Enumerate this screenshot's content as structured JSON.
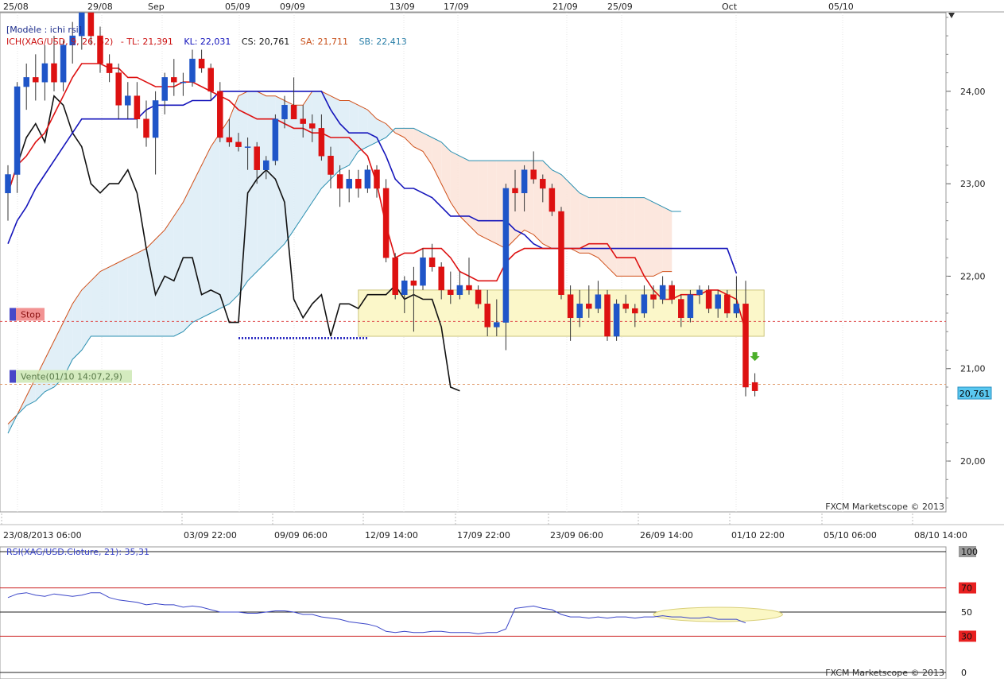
{
  "chart_data": {
    "type": "candlestick",
    "symbol": "XAG/USD",
    "header_label": "[Modèle : ichi rsi]",
    "indicator_label": {
      "ich": "ICH(XAG/USD, 9, 26, 52)",
      "tl": "- TL: 21,391",
      "kl": "KL: 22,031",
      "cs": "CS: 20,761",
      "sa": "SA: 21,711",
      "sb": "SB: 22,413"
    },
    "watermark": "FXCM Marketscope © 2013",
    "top_dates": [
      "25/08",
      "29/08",
      "Sep",
      "05/09",
      "09/09",
      "13/09",
      "17/09",
      "21/09",
      "25/09",
      "Oct",
      "05/10"
    ],
    "bottom_dates": [
      "23/08/2013 06:00",
      "03/09 22:00",
      "09/09 06:00",
      "12/09 14:00",
      "17/09 22:00",
      "23/09 06:00",
      "26/09 14:00",
      "01/10 22:00",
      "05/10 06:00",
      "08/10 14:00"
    ],
    "price_ticks": [
      "24,00",
      "23,00",
      "22,00",
      "21,00",
      "20,00"
    ],
    "current_price": "20,761",
    "ylim": [
      19.45,
      24.85
    ],
    "candles": [
      {
        "o": 22.9,
        "h": 23.2,
        "l": 22.6,
        "c": 23.1
      },
      {
        "o": 23.1,
        "h": 24.1,
        "l": 22.9,
        "c": 24.05
      },
      {
        "o": 24.05,
        "h": 24.3,
        "l": 23.8,
        "c": 24.15
      },
      {
        "o": 24.15,
        "h": 24.4,
        "l": 23.9,
        "c": 24.1
      },
      {
        "o": 24.1,
        "h": 24.5,
        "l": 23.9,
        "c": 24.3
      },
      {
        "o": 24.3,
        "h": 24.6,
        "l": 24.0,
        "c": 24.1
      },
      {
        "o": 24.1,
        "h": 24.55,
        "l": 24.0,
        "c": 24.5
      },
      {
        "o": 24.5,
        "h": 24.75,
        "l": 24.3,
        "c": 24.6
      },
      {
        "o": 24.6,
        "h": 24.85,
        "l": 24.45,
        "c": 24.85
      },
      {
        "o": 24.85,
        "h": 24.85,
        "l": 24.5,
        "c": 24.6
      },
      {
        "o": 24.6,
        "h": 24.7,
        "l": 24.2,
        "c": 24.3
      },
      {
        "o": 24.3,
        "h": 24.4,
        "l": 24.1,
        "c": 24.2
      },
      {
        "o": 24.2,
        "h": 24.3,
        "l": 23.7,
        "c": 23.85
      },
      {
        "o": 23.85,
        "h": 24.1,
        "l": 23.7,
        "c": 23.95
      },
      {
        "o": 23.95,
        "h": 24.1,
        "l": 23.6,
        "c": 23.7
      },
      {
        "o": 23.7,
        "h": 23.9,
        "l": 23.4,
        "c": 23.5
      },
      {
        "o": 23.5,
        "h": 24.0,
        "l": 23.1,
        "c": 23.9
      },
      {
        "o": 23.9,
        "h": 24.2,
        "l": 23.75,
        "c": 24.15
      },
      {
        "o": 24.15,
        "h": 24.35,
        "l": 23.95,
        "c": 24.1
      },
      {
        "o": 24.1,
        "h": 24.2,
        "l": 23.95,
        "c": 24.1
      },
      {
        "o": 24.1,
        "h": 24.45,
        "l": 24.05,
        "c": 24.35
      },
      {
        "o": 24.35,
        "h": 24.45,
        "l": 24.2,
        "c": 24.25
      },
      {
        "o": 24.25,
        "h": 24.3,
        "l": 23.9,
        "c": 24.0
      },
      {
        "o": 24.0,
        "h": 24.1,
        "l": 23.45,
        "c": 23.5
      },
      {
        "o": 23.5,
        "h": 23.7,
        "l": 23.4,
        "c": 23.45
      },
      {
        "o": 23.45,
        "h": 23.55,
        "l": 23.35,
        "c": 23.4
      },
      {
        "o": 23.4,
        "h": 23.5,
        "l": 23.15,
        "c": 23.4
      },
      {
        "o": 23.4,
        "h": 23.45,
        "l": 23.0,
        "c": 23.15
      },
      {
        "o": 23.15,
        "h": 23.3,
        "l": 23.05,
        "c": 23.25
      },
      {
        "o": 23.25,
        "h": 23.75,
        "l": 23.2,
        "c": 23.7
      },
      {
        "o": 23.7,
        "h": 23.95,
        "l": 23.6,
        "c": 23.85
      },
      {
        "o": 23.85,
        "h": 24.15,
        "l": 23.7,
        "c": 23.7
      },
      {
        "o": 23.7,
        "h": 23.85,
        "l": 23.5,
        "c": 23.65
      },
      {
        "o": 23.65,
        "h": 23.75,
        "l": 23.45,
        "c": 23.6
      },
      {
        "o": 23.6,
        "h": 23.75,
        "l": 23.25,
        "c": 23.3
      },
      {
        "o": 23.3,
        "h": 23.4,
        "l": 22.95,
        "c": 23.1
      },
      {
        "o": 23.1,
        "h": 23.2,
        "l": 22.75,
        "c": 22.95
      },
      {
        "o": 22.95,
        "h": 23.15,
        "l": 22.8,
        "c": 23.05
      },
      {
        "o": 23.05,
        "h": 23.15,
        "l": 22.85,
        "c": 22.95
      },
      {
        "o": 22.95,
        "h": 23.2,
        "l": 22.9,
        "c": 23.15
      },
      {
        "o": 23.15,
        "h": 23.2,
        "l": 22.85,
        "c": 22.95
      },
      {
        "o": 22.95,
        "h": 23.05,
        "l": 22.15,
        "c": 22.2
      },
      {
        "o": 22.2,
        "h": 22.25,
        "l": 21.75,
        "c": 21.8
      },
      {
        "o": 21.8,
        "h": 22.0,
        "l": 21.6,
        "c": 21.95
      },
      {
        "o": 21.95,
        "h": 22.1,
        "l": 21.4,
        "c": 21.9
      },
      {
        "o": 21.9,
        "h": 22.3,
        "l": 21.85,
        "c": 22.2
      },
      {
        "o": 22.2,
        "h": 22.35,
        "l": 22.05,
        "c": 22.1
      },
      {
        "o": 22.1,
        "h": 22.15,
        "l": 21.75,
        "c": 21.85
      },
      {
        "o": 21.85,
        "h": 22.05,
        "l": 21.7,
        "c": 21.8
      },
      {
        "o": 21.8,
        "h": 22.05,
        "l": 21.75,
        "c": 21.9
      },
      {
        "o": 21.9,
        "h": 22.2,
        "l": 21.8,
        "c": 21.85
      },
      {
        "o": 21.85,
        "h": 21.9,
        "l": 21.65,
        "c": 21.7
      },
      {
        "o": 21.7,
        "h": 21.85,
        "l": 21.35,
        "c": 21.45
      },
      {
        "o": 21.45,
        "h": 21.75,
        "l": 21.35,
        "c": 21.5
      },
      {
        "o": 21.5,
        "h": 23.0,
        "l": 21.2,
        "c": 22.95
      },
      {
        "o": 22.95,
        "h": 23.15,
        "l": 22.7,
        "c": 22.9
      },
      {
        "o": 22.9,
        "h": 23.2,
        "l": 22.7,
        "c": 23.15
      },
      {
        "o": 23.15,
        "h": 23.35,
        "l": 23.0,
        "c": 23.05
      },
      {
        "o": 23.05,
        "h": 23.1,
        "l": 22.8,
        "c": 22.95
      },
      {
        "o": 22.95,
        "h": 23.0,
        "l": 22.65,
        "c": 22.7
      },
      {
        "o": 22.7,
        "h": 22.75,
        "l": 21.75,
        "c": 21.8
      },
      {
        "o": 21.8,
        "h": 21.9,
        "l": 21.3,
        "c": 21.55
      },
      {
        "o": 21.55,
        "h": 21.85,
        "l": 21.45,
        "c": 21.7
      },
      {
        "o": 21.7,
        "h": 21.9,
        "l": 21.55,
        "c": 21.65
      },
      {
        "o": 21.65,
        "h": 21.95,
        "l": 21.6,
        "c": 21.8
      },
      {
        "o": 21.8,
        "h": 21.85,
        "l": 21.3,
        "c": 21.35
      },
      {
        "o": 21.35,
        "h": 21.75,
        "l": 21.3,
        "c": 21.7
      },
      {
        "o": 21.7,
        "h": 21.8,
        "l": 21.6,
        "c": 21.65
      },
      {
        "o": 21.65,
        "h": 21.7,
        "l": 21.45,
        "c": 21.6
      },
      {
        "o": 21.6,
        "h": 21.9,
        "l": 21.55,
        "c": 21.8
      },
      {
        "o": 21.8,
        "h": 21.9,
        "l": 21.65,
        "c": 21.75
      },
      {
        "o": 21.75,
        "h": 22.0,
        "l": 21.7,
        "c": 21.9
      },
      {
        "o": 21.9,
        "h": 21.95,
        "l": 21.7,
        "c": 21.75
      },
      {
        "o": 21.75,
        "h": 21.8,
        "l": 21.45,
        "c": 21.55
      },
      {
        "o": 21.55,
        "h": 21.85,
        "l": 21.5,
        "c": 21.8
      },
      {
        "o": 21.8,
        "h": 21.9,
        "l": 21.7,
        "c": 21.85
      },
      {
        "o": 21.85,
        "h": 21.9,
        "l": 21.6,
        "c": 21.65
      },
      {
        "o": 21.65,
        "h": 21.85,
        "l": 21.55,
        "c": 21.8
      },
      {
        "o": 21.8,
        "h": 21.85,
        "l": 21.55,
        "c": 21.6
      },
      {
        "o": 21.6,
        "h": 22.0,
        "l": 21.55,
        "c": 21.7
      },
      {
        "o": 21.7,
        "h": 21.95,
        "l": 20.7,
        "c": 20.8
      },
      {
        "o": 20.85,
        "h": 20.95,
        "l": 20.7,
        "c": 20.76
      }
    ],
    "tenkan": [
      22.9,
      23.2,
      23.3,
      23.45,
      23.55,
      23.75,
      23.95,
      24.15,
      24.3,
      24.3,
      24.3,
      24.25,
      24.25,
      24.15,
      24.15,
      24.1,
      24.05,
      24.05,
      24.05,
      24.1,
      24.1,
      24.05,
      24.0,
      23.95,
      23.9,
      23.8,
      23.75,
      23.7,
      23.7,
      23.7,
      23.65,
      23.6,
      23.6,
      23.55,
      23.55,
      23.5,
      23.5,
      23.5,
      23.4,
      23.3,
      23.0,
      22.55,
      22.2,
      22.25,
      22.25,
      22.3,
      22.3,
      22.3,
      22.2,
      22.05,
      22.0,
      21.95,
      21.95,
      21.95,
      22.15,
      22.25,
      22.3,
      22.3,
      22.3,
      22.3,
      22.3,
      22.3,
      22.3,
      22.35,
      22.35,
      22.35,
      22.2,
      22.2,
      22.2,
      22.0,
      21.85,
      21.75,
      21.75,
      21.8,
      21.8,
      21.8,
      21.85,
      21.85,
      21.8,
      21.75,
      21.4
    ],
    "kijun": [
      22.35,
      22.6,
      22.75,
      22.95,
      23.1,
      23.25,
      23.4,
      23.55,
      23.7,
      23.7,
      23.7,
      23.7,
      23.7,
      23.7,
      23.7,
      23.8,
      23.85,
      23.85,
      23.85,
      23.85,
      23.9,
      23.9,
      23.9,
      24.0,
      24.0,
      24.0,
      24.0,
      24.0,
      24.0,
      24.0,
      24.0,
      24.0,
      24.0,
      24.0,
      24.0,
      23.8,
      23.65,
      23.55,
      23.55,
      23.55,
      23.5,
      23.3,
      23.05,
      22.95,
      22.95,
      22.9,
      22.85,
      22.75,
      22.65,
      22.65,
      22.65,
      22.6,
      22.6,
      22.6,
      22.6,
      22.5,
      22.45,
      22.35,
      22.3,
      22.3,
      22.3,
      22.3,
      22.3,
      22.3,
      22.3,
      22.3,
      22.3,
      22.3,
      22.3,
      22.3,
      22.3,
      22.3,
      22.3,
      22.3,
      22.3,
      22.3,
      22.3,
      22.3,
      22.3,
      22.03
    ],
    "chikou": [
      22.9,
      23.2,
      23.5,
      23.65,
      23.45,
      23.95,
      23.85,
      23.55,
      23.4,
      23.0,
      22.9,
      23.0,
      23.0,
      23.15,
      22.9,
      22.3,
      21.8,
      22.0,
      21.95,
      22.2,
      22.2,
      21.8,
      21.85,
      21.8,
      21.5,
      21.5,
      22.9,
      23.05,
      23.15,
      23.05,
      22.8,
      21.75,
      21.55,
      21.7,
      21.8,
      21.35,
      21.7,
      21.7,
      21.65,
      21.8,
      21.8,
      21.8,
      21.9,
      21.75,
      21.8,
      21.75,
      21.75,
      21.45,
      20.8,
      20.76
    ],
    "senkou_a": [
      20.4,
      20.5,
      20.7,
      20.9,
      21.1,
      21.3,
      21.5,
      21.7,
      21.85,
      21.95,
      22.05,
      22.1,
      22.15,
      22.2,
      22.25,
      22.3,
      22.4,
      22.5,
      22.65,
      22.8,
      23.0,
      23.2,
      23.4,
      23.55,
      23.7,
      23.95,
      24.0,
      24.0,
      23.95,
      23.95,
      23.9,
      23.85,
      23.85,
      24.0,
      24.0,
      23.95,
      23.9,
      23.9,
      23.85,
      23.8,
      23.7,
      23.65,
      23.55,
      23.5,
      23.4,
      23.35,
      23.2,
      23.0,
      22.8,
      22.65,
      22.55,
      22.45,
      22.4,
      22.35,
      22.3,
      22.4,
      22.5,
      22.45,
      22.35,
      22.3,
      22.3,
      22.3,
      22.25,
      22.25,
      22.2,
      22.1,
      22.0,
      22.0,
      22.0,
      22.0,
      22.0,
      22.05,
      22.05
    ],
    "senkou_b": [
      20.3,
      20.5,
      20.6,
      20.65,
      20.75,
      20.8,
      20.9,
      21.1,
      21.2,
      21.35,
      21.35,
      21.35,
      21.35,
      21.35,
      21.35,
      21.35,
      21.35,
      21.35,
      21.35,
      21.4,
      21.5,
      21.55,
      21.6,
      21.65,
      21.7,
      21.8,
      21.95,
      22.05,
      22.15,
      22.25,
      22.35,
      22.5,
      22.65,
      22.8,
      22.95,
      23.05,
      23.15,
      23.2,
      23.35,
      23.4,
      23.45,
      23.5,
      23.6,
      23.6,
      23.6,
      23.55,
      23.5,
      23.45,
      23.35,
      23.3,
      23.25,
      23.25,
      23.25,
      23.25,
      23.25,
      23.25,
      23.25,
      23.25,
      23.25,
      23.15,
      23.1,
      23.0,
      22.9,
      22.85,
      22.85,
      22.85,
      22.85,
      22.85,
      22.85,
      22.85,
      22.8,
      22.75,
      22.7,
      22.7
    ],
    "stop_label": "Stop",
    "stop_price": 21.51,
    "vente_label": "Vente(01/10 14:07,2,9)",
    "vente_price": 20.83,
    "range_box": {
      "x_from": 38,
      "x_to": 82,
      "y_low": 21.35,
      "y_high": 21.85
    },
    "rsi": {
      "label": "RSI(XAG/USD.Cloture, 21): 35,31",
      "ticks": [
        "100",
        "70",
        "50",
        "30",
        "0"
      ],
      "levels": [
        100,
        70,
        50,
        30,
        0
      ],
      "values": [
        62,
        65,
        66,
        64,
        63,
        65,
        64,
        63,
        64,
        66,
        66,
        62,
        60,
        59,
        58,
        56,
        57,
        56,
        56,
        54,
        55,
        54,
        52,
        50,
        50,
        50,
        49,
        49,
        50,
        51,
        51,
        50,
        48,
        48,
        46,
        45,
        44,
        42,
        41,
        40,
        38,
        34,
        33,
        34,
        33,
        33,
        34,
        34,
        33,
        33,
        33,
        32,
        33,
        33,
        36,
        53,
        54,
        55,
        53,
        52,
        48,
        46,
        46,
        45,
        46,
        45,
        46,
        46,
        45,
        46,
        46,
        47,
        46,
        46,
        45,
        45,
        46,
        44,
        44,
        44,
        41
      ],
      "ellipse": {
        "x_from": 70,
        "x_to": 84,
        "center": 48
      }
    }
  }
}
